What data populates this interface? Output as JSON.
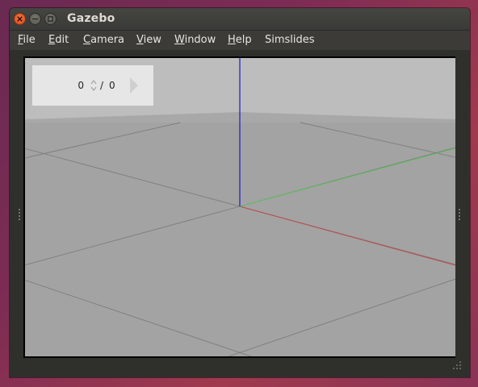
{
  "window": {
    "title": "Gazebo",
    "controls": [
      "close-icon",
      "minimize-icon",
      "maximize-icon"
    ]
  },
  "menu": [
    {
      "mnemonic": "F",
      "rest": "ile"
    },
    {
      "mnemonic": "E",
      "rest": "dit"
    },
    {
      "mnemonic": "C",
      "rest": "amera"
    },
    {
      "mnemonic": "V",
      "rest": "iew"
    },
    {
      "mnemonic": "W",
      "rest": "indow"
    },
    {
      "mnemonic": "H",
      "rest": "elp"
    },
    {
      "mnemonic": "",
      "rest": "Simslides"
    }
  ],
  "simslides": {
    "current": "0",
    "separator": "/",
    "total": "0",
    "next_icon": "chevron-right-icon"
  },
  "scene": {
    "sky_color": "#bdbdbd",
    "ground_color": "#a3a3a3",
    "horizon_band_color": "#a8a8a8",
    "grid_color": "#7d7d7d",
    "axis_x_color": "#c04848",
    "axis_y_color": "#5cc05c",
    "axis_z_color": "#1a1ad0"
  }
}
